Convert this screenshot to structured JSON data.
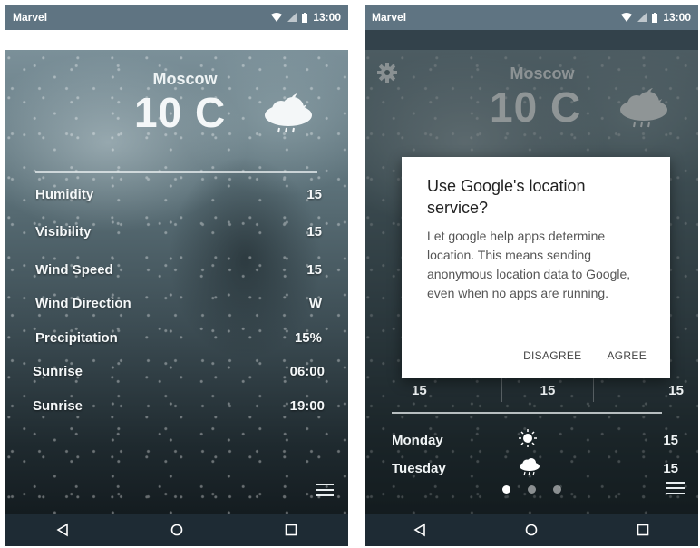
{
  "left_screen": {
    "status_bar": {
      "carrier": "Marvel",
      "time": "13:00"
    },
    "city": "Moscow",
    "temperature": "10 C",
    "weather_icon": "cloud-moon-rain-icon",
    "details": [
      {
        "label": "Humidity",
        "value": "15"
      },
      {
        "label": "Visibility",
        "value": "15"
      },
      {
        "label": "Wind Speed",
        "value": "15"
      },
      {
        "label": "Wind Direction",
        "value": "W"
      },
      {
        "label": "Precipitation",
        "value": "15%"
      },
      {
        "label": "Sunrise",
        "value": "06:00"
      },
      {
        "label": "Sunrise",
        "value": "19:00"
      }
    ],
    "menu_icon": "hamburger-menu-icon"
  },
  "right_screen": {
    "status_bar": {
      "carrier": "Marvel",
      "time": "13:00"
    },
    "city": "Moscow",
    "temperature": "10 C",
    "weather_icon": "cloud-moon-rain-icon",
    "settings_icon": "gear-icon",
    "dialog": {
      "title": "Use Google's location service?",
      "body": "Let google help apps determine location. This means sending anonymous location data to Google, even when no apps are running.",
      "disagree_label": "DISAGREE",
      "agree_label": "AGREE"
    },
    "grid_values": [
      "15",
      "15",
      "15"
    ],
    "forecast": [
      {
        "day": "Monday",
        "icon": "sun-icon",
        "value": "15"
      },
      {
        "day": "Tuesday",
        "icon": "cloud-rain-icon",
        "value": "15"
      }
    ],
    "pager": {
      "pages": 3,
      "active_index": 0
    },
    "menu_icon": "hamburger-menu-icon"
  },
  "nav_bar": {
    "back_icon": "back-triangle-icon",
    "home_icon": "home-circle-icon",
    "recents_icon": "recents-square-icon"
  },
  "colors": {
    "status_bar": "#5f7482",
    "nav_bar": "#1e2b34",
    "dialog_bg": "#ffffff",
    "text_light": "#f5f8f9"
  }
}
